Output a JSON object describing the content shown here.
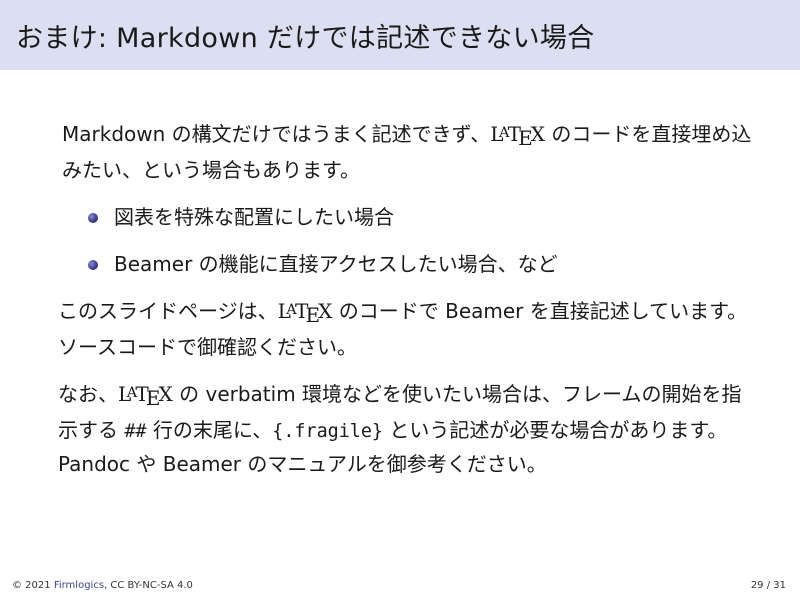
{
  "slide": {
    "title": "おまけ: Markdown だけでは記述できない場合"
  },
  "content": {
    "p1": {
      "a": "Markdown の構文だけではうまく記述できず、",
      "latex_logo": "LaTeX",
      "b": " のコードを直接埋め込みたい、という場合もあります。"
    },
    "bullets": [
      "図表を特殊な配置にしたい場合",
      "Beamer の機能に直接アクセスしたい場合、など"
    ],
    "p2": {
      "a": "このスライドページは、",
      "latex_logo": "LaTeX",
      "b": " のコードで Beamer を直接記述しています。ソースコードで御確認ください。"
    },
    "p3": {
      "a": "なお、",
      "latex_logo": "LaTeX",
      "b": " の verbatim 環境などを使いたい場合は、フレームの開始を指示する ",
      "code1": "##",
      "c": " 行の末尾に、",
      "code2": "{.fragile}",
      "d": " という記述が必要な場合があります。Pandoc や Beamer のマニュアルを御参考ください。"
    }
  },
  "footer": {
    "copyright": "© 2021 ",
    "org_link": "Firmlogics",
    "license": ", CC BY-NC-SA 4.0",
    "page": "29 / 31"
  },
  "colors": {
    "title_bar": "#dcdff1",
    "bullet": "#3b3f8f",
    "link": "#3b3f8f"
  }
}
